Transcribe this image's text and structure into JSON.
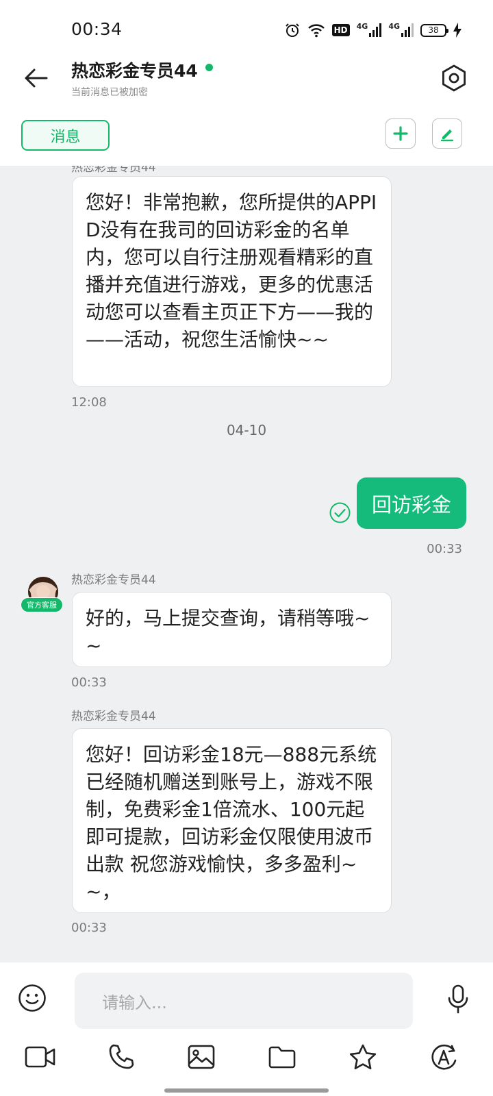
{
  "status_bar": {
    "time": "00:34",
    "hd_label": "HD",
    "signal_1": "4G",
    "signal_2": "4G",
    "battery": "38"
  },
  "header": {
    "title": "热恋彩金专员44",
    "subtitle": "当前消息已被加密"
  },
  "toolbar": {
    "tab_label": "消息"
  },
  "messages": [
    {
      "sender": "热恋彩金专员44",
      "text": "您好！非常抱歉，您所提供的APPID没有在我司的回访彩金的名单内，您可以自行注册观看精彩的直播并充值进行游戏，更多的优惠活动您可以查看主页正下方——我的——活动，祝您生活愉快~~",
      "time": "12:08"
    },
    {
      "date_separator": "04-10"
    },
    {
      "direction": "out",
      "text": "回访彩金",
      "time": "00:33"
    },
    {
      "sender": "热恋彩金专员44",
      "avatar_badge": "官方客服",
      "text": "好的，马上提交查询，请稍等哦~~",
      "time": "00:33"
    },
    {
      "sender": "热恋彩金专员44",
      "text": "您好！回访彩金18元—888元系统已经随机赠送到账号上，游戏不限制，免费彩金1倍流水、100元起即可提款，回访彩金仅限使用波币出款 祝您游戏愉快，多多盈利~~，",
      "time": "00:33"
    }
  ],
  "input": {
    "placeholder": "请输入..."
  },
  "icons": {
    "accent_color": "#14b86a",
    "bottom_actions": [
      "video-camera-icon",
      "phone-icon",
      "image-icon",
      "folder-icon",
      "star-icon",
      "translate-icon"
    ]
  }
}
